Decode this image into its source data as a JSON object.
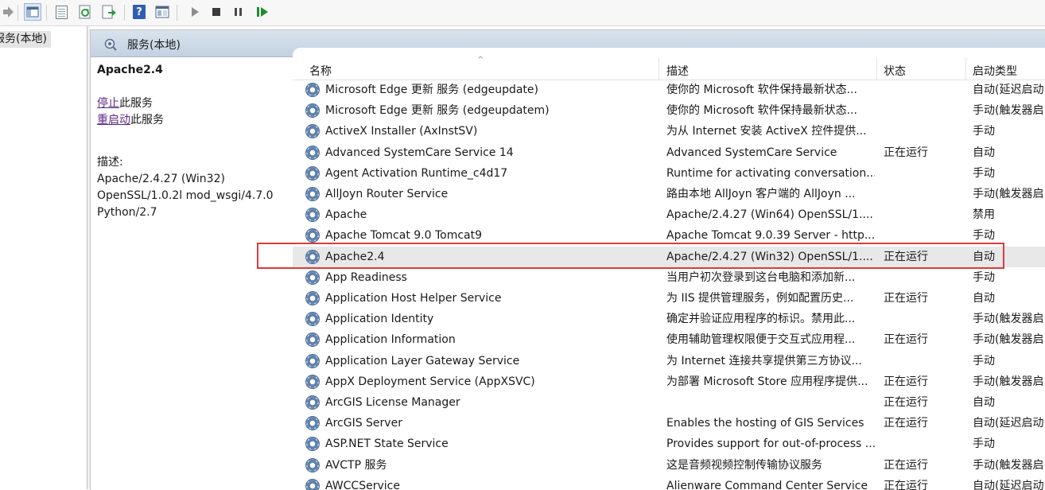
{
  "tree": {
    "item_label": "服务(本地)"
  },
  "panel": {
    "title": "服务(本地)"
  },
  "detail": {
    "service_name": "Apache2.4",
    "stop_link": "停止",
    "stop_suffix": "此服务",
    "restart_link": "重启动",
    "restart_suffix": "此服务",
    "desc_label": "描述:",
    "desc_lines": [
      "Apache/2.4.27 (Win32)",
      "OpenSSL/1.0.2l mod_wsgi/4.7.0",
      "Python/2.7"
    ]
  },
  "columns": {
    "name": "名称",
    "desc": "描述",
    "status": "状态",
    "start": "启动类型"
  },
  "colors": {
    "highlight_border": "#e0393c",
    "selected_row": "#e8e8e8",
    "link": "#5b2a86"
  },
  "rows": [
    {
      "name": "Microsoft Edge 更新 服务 (edgeupdate)",
      "desc": "使你的 Microsoft 软件保持最新状态...",
      "status": "",
      "start": "自动(延迟启动"
    },
    {
      "name": "Microsoft Edge 更新 服务 (edgeupdatem)",
      "desc": "使你的 Microsoft 软件保持最新状态...",
      "status": "",
      "start": "手动(触发器启"
    },
    {
      "name": "ActiveX Installer (AxInstSV)",
      "desc": "为从 Internet 安装 ActiveX 控件提供...",
      "status": "",
      "start": "手动"
    },
    {
      "name": "Advanced SystemCare Service 14",
      "desc": "Advanced SystemCare Service",
      "status": "正在运行",
      "start": "自动"
    },
    {
      "name": "Agent Activation Runtime_c4d17",
      "desc": "Runtime for activating conversation...",
      "status": "",
      "start": "手动"
    },
    {
      "name": "AllJoyn Router Service",
      "desc": "路由本地 AllJoyn 客户端的 AllJoyn ...",
      "status": "",
      "start": "手动(触发器启"
    },
    {
      "name": "Apache",
      "desc": "Apache/2.4.27 (Win64) OpenSSL/1....",
      "status": "",
      "start": "禁用"
    },
    {
      "name": "Apache Tomcat 9.0 Tomcat9",
      "desc": "Apache Tomcat 9.0.39 Server - http...",
      "status": "",
      "start": "手动"
    },
    {
      "name": "Apache2.4",
      "desc": "Apache/2.4.27 (Win32) OpenSSL/1....",
      "status": "正在运行",
      "start": "自动",
      "selected": true
    },
    {
      "name": "App Readiness",
      "desc": "当用户初次登录到这台电脑和添加新...",
      "status": "",
      "start": "手动"
    },
    {
      "name": "Application Host Helper Service",
      "desc": "为 IIS 提供管理服务，例如配置历史...",
      "status": "正在运行",
      "start": "自动"
    },
    {
      "name": "Application Identity",
      "desc": "确定并验证应用程序的标识。禁用此...",
      "status": "",
      "start": "手动(触发器启"
    },
    {
      "name": "Application Information",
      "desc": "使用辅助管理权限便于交互式应用程...",
      "status": "正在运行",
      "start": "手动(触发器启"
    },
    {
      "name": "Application Layer Gateway Service",
      "desc": "为 Internet 连接共享提供第三方协议...",
      "status": "",
      "start": "手动"
    },
    {
      "name": "AppX Deployment Service (AppXSVC)",
      "desc": "为部署 Microsoft Store 应用程序提供...",
      "status": "正在运行",
      "start": "手动(触发器启"
    },
    {
      "name": "ArcGIS License Manager",
      "desc": "",
      "status": "正在运行",
      "start": "自动"
    },
    {
      "name": "ArcGIS Server",
      "desc": "Enables the hosting of GIS Services",
      "status": "正在运行",
      "start": "自动(延迟启动"
    },
    {
      "name": "ASP.NET State Service",
      "desc": "Provides support for out-of-process ...",
      "status": "",
      "start": "手动"
    },
    {
      "name": "AVCTP 服务",
      "desc": "这是音频视频控制传输协议服务",
      "status": "正在运行",
      "start": "手动(触发器启"
    },
    {
      "name": "AWCCService",
      "desc": "Alienware Command Center Service",
      "status": "正在运行",
      "start": "自动(延迟启动"
    }
  ]
}
